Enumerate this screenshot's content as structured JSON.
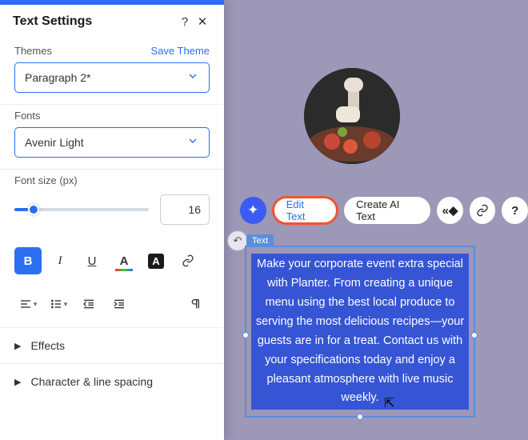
{
  "panel": {
    "title": "Text Settings",
    "themes": {
      "label": "Themes",
      "save": "Save Theme",
      "value": "Paragraph 2*"
    },
    "fonts": {
      "label": "Fonts",
      "value": "Avenir Light"
    },
    "fontsize": {
      "label": "Font size (px)",
      "value": "16"
    },
    "accordion": {
      "effects": "Effects",
      "char": "Character & line spacing"
    }
  },
  "toolbar": {
    "edit": "Edit Text",
    "create_ai": "Create AI Text",
    "text_tag": "Text"
  },
  "textbox": {
    "content": "Make your corporate event extra special with Planter. From creating a unique menu using the best local produce to serving the most delicious recipes—your guests are in for a treat. Contact us with your specifications today and enjoy a pleasant atmosphere with live music weekly."
  }
}
